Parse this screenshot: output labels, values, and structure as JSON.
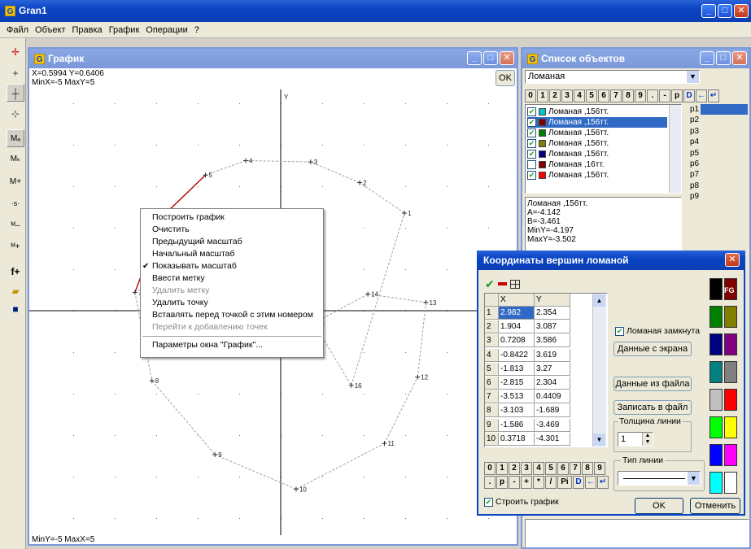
{
  "app": {
    "title": "Gran1",
    "icon": "G"
  },
  "menu": [
    "Файл",
    "Объект",
    "Правка",
    "График",
    "Операции",
    "?"
  ],
  "graph_window": {
    "title": "График",
    "coords_line": "X=0.5994 Y=0.6406",
    "range_top": "MinX=-5 MaxY=5",
    "range_bottom": "MinY=-5 MaxX=5",
    "ok_label": "OK",
    "y_axis_label": "Y",
    "x_axis_label": "X"
  },
  "context_menu": {
    "items": [
      {
        "label": "Построить график",
        "disabled": false,
        "checked": false
      },
      {
        "label": "Очистить",
        "disabled": false,
        "checked": false
      },
      {
        "label": "Предыдущий масштаб",
        "disabled": false,
        "checked": false
      },
      {
        "label": "Начальный масштаб",
        "disabled": false,
        "checked": false
      },
      {
        "label": "Показывать масштаб",
        "disabled": false,
        "checked": true
      },
      {
        "label": "Ввести метку",
        "disabled": false,
        "checked": false
      },
      {
        "label": "Удалить метку",
        "disabled": true,
        "checked": false
      },
      {
        "label": "Удалить точку",
        "disabled": false,
        "checked": false
      },
      {
        "label": "Вставлять перед точкой с этим номером",
        "disabled": false,
        "checked": false
      },
      {
        "label": "Перейти к добавлению точек",
        "disabled": true,
        "checked": false
      }
    ],
    "footer_item": "Параметры окна \"График\"..."
  },
  "objects_window": {
    "title": "Список объектов",
    "type_select": "Ломаная",
    "keypad": [
      "0",
      "1",
      "2",
      "3",
      "4",
      "5",
      "6",
      "7",
      "8",
      "9",
      ".",
      "-",
      "p",
      "D"
    ],
    "items": [
      {
        "label": "Ломаная ,156тт.",
        "checked": true,
        "color": "#00c8c8",
        "selected": false
      },
      {
        "label": "Ломаная ,156тт.",
        "checked": true,
        "color": "#800000",
        "selected": true
      },
      {
        "label": "Ломаная ,156тт.",
        "checked": true,
        "color": "#008000",
        "selected": false
      },
      {
        "label": "Ломаная ,156тт.",
        "checked": true,
        "color": "#808000",
        "selected": false
      },
      {
        "label": "Ломаная ,156тт.",
        "checked": true,
        "color": "#000080",
        "selected": false
      },
      {
        "label": "Ломаная ,16тт.",
        "checked": false,
        "color": "#800000",
        "selected": false
      },
      {
        "label": "Ломаная ,156тт.",
        "checked": true,
        "color": "#ff0000",
        "selected": false
      }
    ],
    "params": [
      "p1",
      "p2",
      "p3",
      "p4",
      "p5",
      "p6",
      "p7",
      "p8",
      "p9"
    ],
    "info": [
      "Ломаная ,156тт.",
      "A=-4.142",
      "B=-3.461",
      "MinY=-4.197",
      "MaxY=-3.502"
    ]
  },
  "coords_dialog": {
    "title": "Координаты вершин ломаной",
    "col_x": "X",
    "col_y": "Y",
    "rows": [
      {
        "n": "1",
        "x": "2.982",
        "y": "2.354"
      },
      {
        "n": "2",
        "x": "1.904",
        "y": "3.087"
      },
      {
        "n": "3",
        "x": "0.7208",
        "y": "3.586"
      },
      {
        "n": "4",
        "x": "-0.8422",
        "y": "3.619"
      },
      {
        "n": "5",
        "x": "-1.813",
        "y": "3.27"
      },
      {
        "n": "6",
        "x": "-2.815",
        "y": "2.304"
      },
      {
        "n": "7",
        "x": "-3.513",
        "y": "0.4409"
      },
      {
        "n": "8",
        "x": "-3.103",
        "y": "-1.689"
      },
      {
        "n": "9",
        "x": "-1.586",
        "y": "-3.469"
      },
      {
        "n": "10",
        "x": "0.3718",
        "y": "-4.301"
      }
    ],
    "closed_checkbox": "Ломаная замкнута",
    "btn_from_screen": "Данные с экрана",
    "btn_from_file": "Данные из файла",
    "btn_write_file": "Записать в файл",
    "line_width_label": "Толщина линии",
    "line_width_value": "1",
    "line_type_label": "Тип линии",
    "keypad_row1": [
      "0",
      "1",
      "2",
      "3",
      "4",
      "5",
      "6",
      "7",
      "8",
      "9"
    ],
    "keypad_row2": [
      ".",
      "p",
      "-",
      "+",
      "*",
      "/",
      "Pi",
      "D"
    ],
    "build_checkbox": "Строить график",
    "ok_label": "OK",
    "cancel_label": "Отменить",
    "fg_label": "FG",
    "palette": [
      "#000000",
      "#800000",
      "#008000",
      "#808000",
      "#000080",
      "#800080",
      "#008080",
      "#808080",
      "#c0c0c0",
      "#ff0000",
      "#00ff00",
      "#ffff00",
      "#0000ff",
      "#ff00ff",
      "#00ffff",
      "#ffffff"
    ]
  },
  "chart_data": {
    "type": "line",
    "title": "",
    "xlabel": "X",
    "ylabel": "Y",
    "xlim": [
      -5,
      5
    ],
    "ylim": [
      -5,
      5
    ],
    "closed": true,
    "points": [
      {
        "label": "1",
        "x": 2.982,
        "y": 2.354
      },
      {
        "label": "2",
        "x": 1.904,
        "y": 3.087
      },
      {
        "label": "3",
        "x": 0.7208,
        "y": 3.586
      },
      {
        "label": "4",
        "x": -0.8422,
        "y": 3.619
      },
      {
        "label": "5",
        "x": -1.813,
        "y": 3.27
      },
      {
        "label": "6",
        "x": -2.815,
        "y": 2.304
      },
      {
        "label": "7",
        "x": -3.513,
        "y": 0.4409
      },
      {
        "label": "8",
        "x": -3.103,
        "y": -1.689
      },
      {
        "label": "9",
        "x": -1.586,
        "y": -3.469
      },
      {
        "label": "10",
        "x": 0.3718,
        "y": -4.301
      },
      {
        "label": "11",
        "x": 2.5,
        "y": -3.2
      },
      {
        "label": "12",
        "x": 3.3,
        "y": -1.6
      },
      {
        "label": "13",
        "x": 3.5,
        "y": 0.2
      },
      {
        "label": "14",
        "x": 2.1,
        "y": 0.4
      },
      {
        "label": "15",
        "x": 0.8,
        "y": -0.3
      },
      {
        "label": "16",
        "x": 1.7,
        "y": -1.8
      }
    ],
    "highlight_segment": [
      5,
      6
    ],
    "line_color": "#a0a0a0",
    "highlight_color": "#b00000"
  }
}
